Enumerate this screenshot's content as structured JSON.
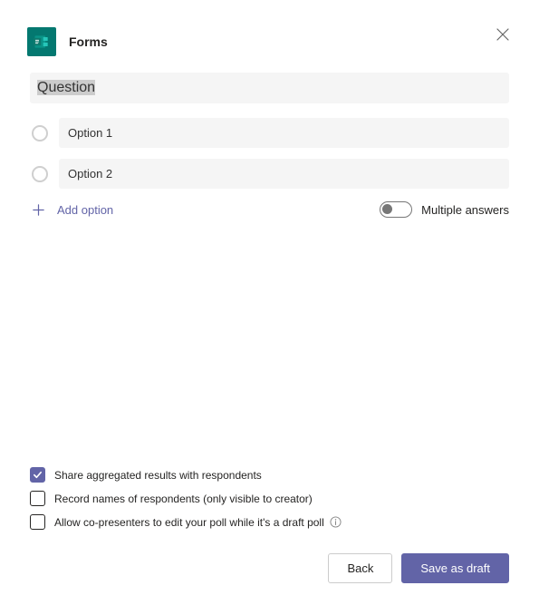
{
  "header": {
    "app_title": "Forms"
  },
  "question": {
    "placeholder_text": "Question"
  },
  "options": [
    {
      "label": "Option 1"
    },
    {
      "label": "Option 2"
    }
  ],
  "add_option_label": "Add option",
  "toggle": {
    "label": "Multiple answers",
    "on": false
  },
  "settings": [
    {
      "label": "Share aggregated results with respondents",
      "checked": true,
      "info": false
    },
    {
      "label": "Record names of respondents (only visible to creator)",
      "checked": false,
      "info": false
    },
    {
      "label": "Allow co-presenters to edit your poll while it's a draft poll",
      "checked": false,
      "info": true
    }
  ],
  "buttons": {
    "back": "Back",
    "save": "Save as draft"
  }
}
